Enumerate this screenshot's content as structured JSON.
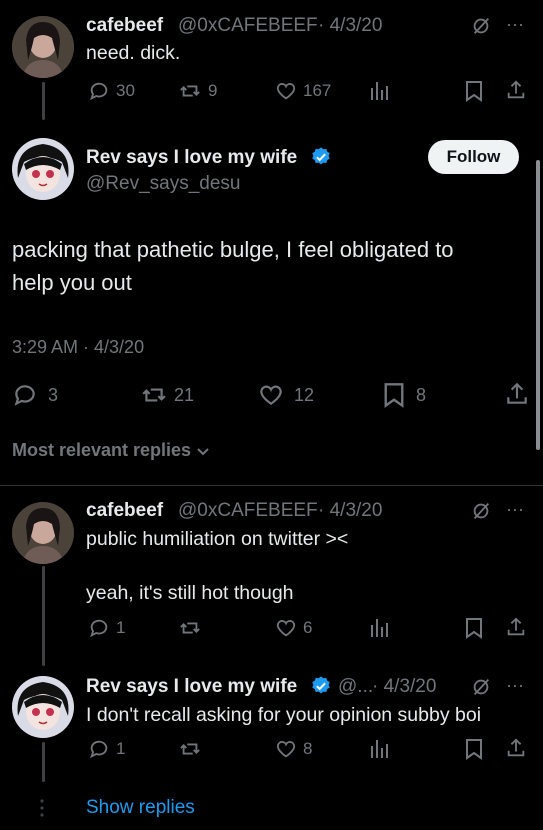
{
  "tweet_parent": {
    "display_name": "cafebeef",
    "handle": "@0xCAFEBEEF",
    "date": "· 4/3/20",
    "text": "need. dick.",
    "replies": "30",
    "retweets": "9",
    "likes": "167"
  },
  "main_tweet": {
    "display_name": "Rev says I love my wife",
    "handle": "@Rev_says_desu",
    "follow_label": "Follow",
    "text_line1": "packing that pathetic bulge, I feel obligated to",
    "text_line2": "help you out",
    "timestamp": "3:29 AM · 4/3/20",
    "replies": "3",
    "retweets": "21",
    "likes": "12",
    "bookmarks": "8"
  },
  "replies_header": {
    "label": "Most relevant replies"
  },
  "reply1": {
    "display_name": "cafebeef",
    "handle": "@0xCAFEBEEF",
    "date": "· 4/3/20",
    "text_line1": "public humiliation on twitter ><",
    "text_line2": "yeah, it's still hot though",
    "replies": "1",
    "retweets": "",
    "likes": "6"
  },
  "reply2": {
    "display_name": "Rev says I love my wife",
    "handle": "@...",
    "date": "· 4/3/20",
    "text": "I don't recall asking for your opinion subby boi",
    "replies": "1",
    "retweets": "",
    "likes": "8"
  },
  "show_replies": {
    "label": "Show replies"
  },
  "colors": {
    "background": "#000000",
    "text": "#e7e9ea",
    "muted": "#71767b",
    "accent": "#1d9bf0"
  },
  "icons": [
    "reply-icon",
    "retweet-icon",
    "like-icon",
    "views-icon",
    "bookmark-icon",
    "share-icon",
    "grok-icon",
    "more-icon",
    "verified-icon",
    "chevron-down-icon"
  ]
}
